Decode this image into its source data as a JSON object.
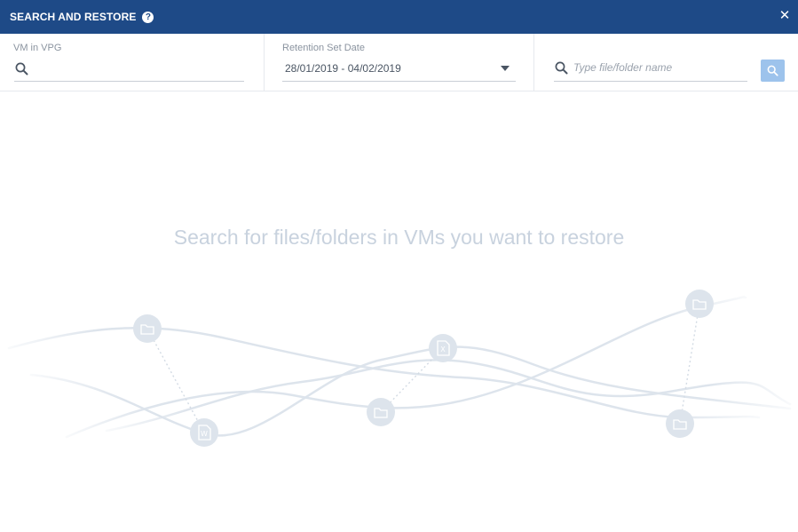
{
  "titlebar": {
    "title": "SEARCH AND RESTORE",
    "help_glyph": "?",
    "close_glyph": "✕"
  },
  "filters": {
    "vm": {
      "label": "VM in VPG",
      "value": "",
      "placeholder": ""
    },
    "date": {
      "label": "Retention Set Date",
      "value": "28/01/2019 - 04/02/2019"
    },
    "file": {
      "placeholder": "Type file/folder name",
      "value": ""
    }
  },
  "empty_state": {
    "message": "Search for files/folders in VMs you want to restore"
  },
  "icons": {
    "titlebar": [
      "help-icon",
      "close-icon"
    ],
    "filters": [
      "vm-search-icon",
      "dropdown-caret-icon",
      "file-search-icon",
      "search-button-icon"
    ],
    "illustration": [
      "folder-icon",
      "word-file-icon",
      "excel-file-icon"
    ]
  },
  "colors": {
    "header": "#1e4a87",
    "search_button": "#9dc3ec",
    "empty_text": "#c8d2de",
    "illustration": "#dde4ec"
  }
}
